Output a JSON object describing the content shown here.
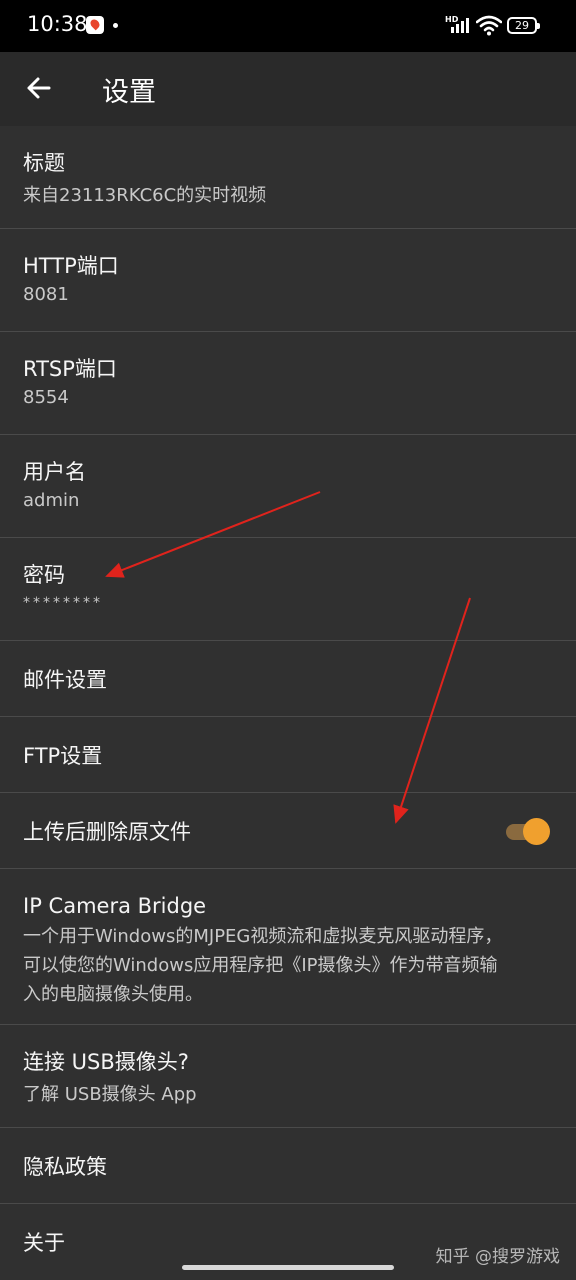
{
  "status_bar": {
    "time": "10:38",
    "network_badge": "HD",
    "battery": "29",
    "icons": [
      "map-pin-app-icon",
      "notification-dot",
      "signal-icon",
      "wifi-icon",
      "battery-icon"
    ]
  },
  "app_bar": {
    "title": "设置",
    "back_icon": "arrow-left-icon"
  },
  "settings": {
    "title": {
      "label": "标题",
      "value": "来自23113RKC6C的实时视频"
    },
    "http_port": {
      "label": "HTTP端口",
      "value": "8081"
    },
    "rtsp_port": {
      "label": "RTSP端口",
      "value": "8554"
    },
    "username": {
      "label": "用户名",
      "value": "admin"
    },
    "password": {
      "label": "密码",
      "value": "********"
    },
    "mail": {
      "label": "邮件设置"
    },
    "ftp": {
      "label": "FTP设置"
    },
    "delete_after_upload": {
      "label": "上传后删除原文件",
      "enabled": true
    },
    "ip_camera_bridge": {
      "label": "IP Camera Bridge",
      "description_lines": [
        "一个用于Windows的MJPEG视频流和虚拟麦克风驱动程序，",
        "可以使您的Windows应用程序把《IP摄像头》作为带音频输",
        "入的电脑摄像头使用。"
      ]
    },
    "usb_camera": {
      "label": "连接 USB摄像头?",
      "value": "了解 USB摄像头 App"
    },
    "privacy": {
      "label": "隐私政策"
    },
    "about": {
      "label": "关于"
    }
  },
  "overlay": {
    "watermark": "知乎 @搜罗游戏",
    "annotation_color": "#e0231c"
  },
  "colors": {
    "background": "#303030",
    "app_bar": "#2a2a2a",
    "divider": "#4a4a4a",
    "toggle_accent": "#f0a02e"
  }
}
